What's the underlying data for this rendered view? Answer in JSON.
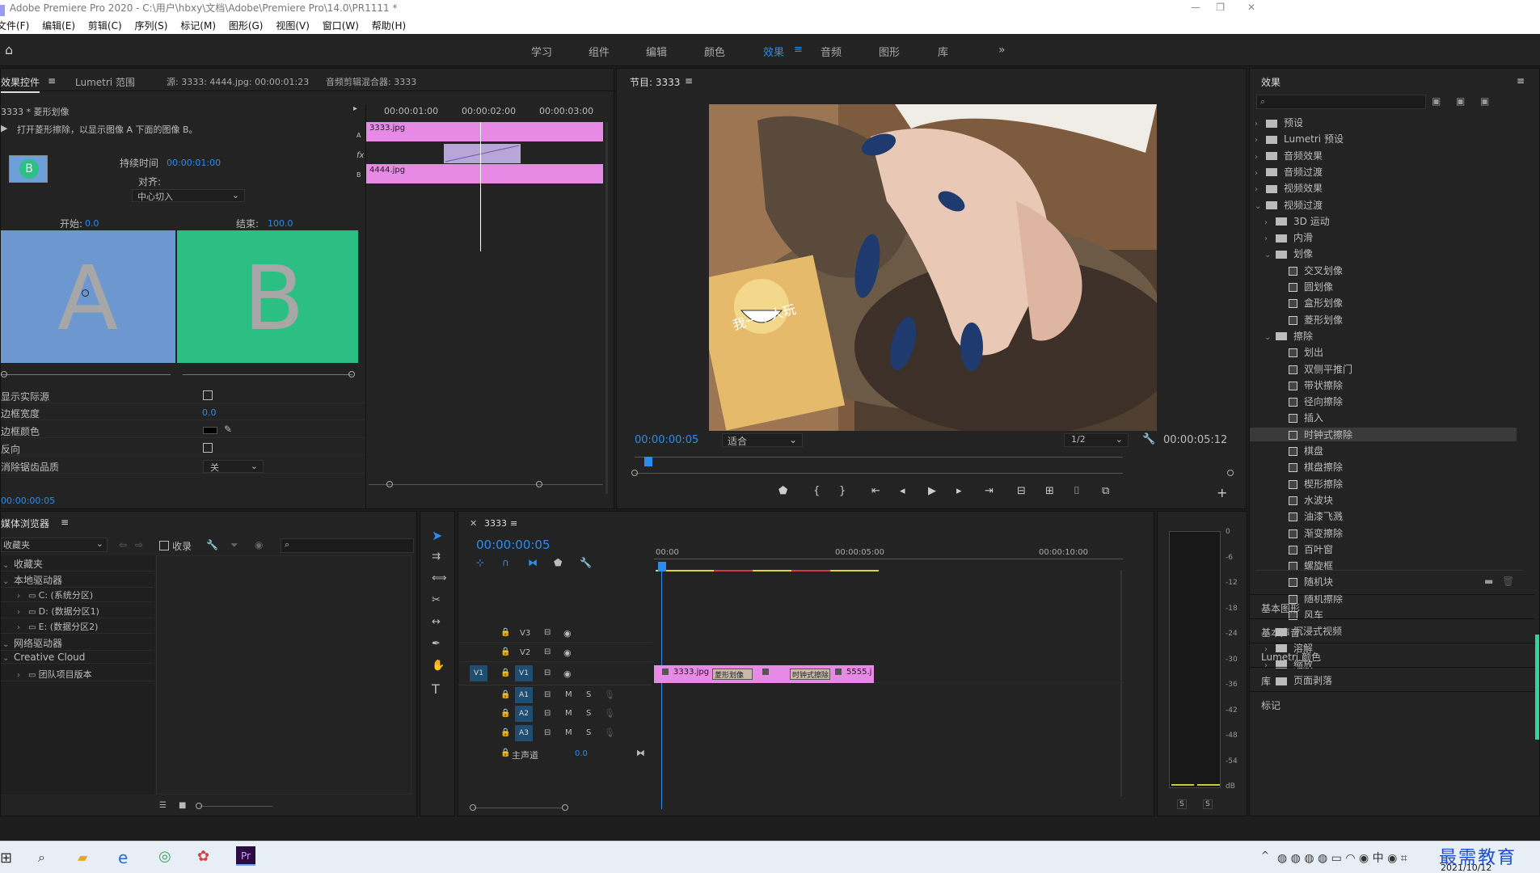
{
  "window": {
    "title": "Adobe Premiere Pro 2020 - C:\\用户\\hbxy\\文档\\Adobe\\Premiere Pro\\14.0\\PR1111 *"
  },
  "menu": [
    "文件(F)",
    "编辑(E)",
    "剪辑(C)",
    "序列(S)",
    "标记(M)",
    "图形(G)",
    "视图(V)",
    "窗口(W)",
    "帮助(H)"
  ],
  "workspaces": [
    "学习",
    "组件",
    "编辑",
    "颜色",
    "效果",
    "音频",
    "图形",
    "库"
  ],
  "workspaces_active": "效果",
  "effect_controls": {
    "tabs": [
      "效果控件",
      "Lumetri 范围",
      "源: 3333: 4444.jpg: 00:00:01:23",
      "音频剪辑混合器: 3333"
    ],
    "clip_name": "3333 * 菱形划像",
    "description": "打开菱形擦除，以显示图像 A 下面的图像 B。",
    "preview_letter": "B",
    "duration_label": "持续时间",
    "duration_value": "00:00:01:00",
    "align_label": "对齐:",
    "align_value": "中心切入",
    "start_label": "开始:",
    "start_value": "0.0",
    "end_label": "结束:",
    "end_value": "100.0",
    "a_letter": "A",
    "b_letter": "B",
    "show_actual": "显示实际源",
    "border_width": "边框宽度",
    "border_width_value": "0.0",
    "border_color": "边框颜色",
    "reverse": "反向",
    "antialias": "消除锯齿品质",
    "antialias_value": "关",
    "timecode": "00:00:00:05",
    "mini_ruler": [
      "00:00:01:00",
      "00:00:02:00",
      "00:00:03:00"
    ],
    "clip_a": "3333.jpg",
    "clip_b": "4444.jpg",
    "lane_a": "A",
    "lane_fx": "fx",
    "lane_b": "B"
  },
  "program": {
    "title": "节目: 3333",
    "timecode": "00:00:00:05",
    "fit": "适合",
    "resolution": "1/2",
    "duration": "00:00:05:12",
    "sticker_text": "我一个人玩"
  },
  "effects_panel": {
    "title": "效果",
    "tree": [
      {
        "label": "预设",
        "level": 0,
        "type": "folder",
        "open": false
      },
      {
        "label": "Lumetri 预设",
        "level": 0,
        "type": "folder",
        "open": false
      },
      {
        "label": "音频效果",
        "level": 0,
        "type": "folder",
        "open": false
      },
      {
        "label": "音频过渡",
        "level": 0,
        "type": "folder",
        "open": false
      },
      {
        "label": "视频效果",
        "level": 0,
        "type": "folder",
        "open": false
      },
      {
        "label": "视频过渡",
        "level": 0,
        "type": "folder",
        "open": true
      },
      {
        "label": "3D 运动",
        "level": 1,
        "type": "folder",
        "open": false
      },
      {
        "label": "内滑",
        "level": 1,
        "type": "folder",
        "open": false
      },
      {
        "label": "划像",
        "level": 1,
        "type": "folder",
        "open": true
      },
      {
        "label": "交叉划像",
        "level": 2,
        "type": "fx"
      },
      {
        "label": "圆划像",
        "level": 2,
        "type": "fx"
      },
      {
        "label": "盒形划像",
        "level": 2,
        "type": "fx"
      },
      {
        "label": "菱形划像",
        "level": 2,
        "type": "fx"
      },
      {
        "label": "擦除",
        "level": 1,
        "type": "folder",
        "open": true
      },
      {
        "label": "划出",
        "level": 2,
        "type": "fx"
      },
      {
        "label": "双侧平推门",
        "level": 2,
        "type": "fx"
      },
      {
        "label": "带状擦除",
        "level": 2,
        "type": "fx"
      },
      {
        "label": "径向擦除",
        "level": 2,
        "type": "fx"
      },
      {
        "label": "插入",
        "level": 2,
        "type": "fx"
      },
      {
        "label": "时钟式擦除",
        "level": 2,
        "type": "fx",
        "selected": true
      },
      {
        "label": "棋盘",
        "level": 2,
        "type": "fx"
      },
      {
        "label": "棋盘擦除",
        "level": 2,
        "type": "fx"
      },
      {
        "label": "楔形擦除",
        "level": 2,
        "type": "fx"
      },
      {
        "label": "水波块",
        "level": 2,
        "type": "fx"
      },
      {
        "label": "油漆飞溅",
        "level": 2,
        "type": "fx"
      },
      {
        "label": "渐变擦除",
        "level": 2,
        "type": "fx"
      },
      {
        "label": "百叶窗",
        "level": 2,
        "type": "fx"
      },
      {
        "label": "螺旋框",
        "level": 2,
        "type": "fx"
      },
      {
        "label": "随机块",
        "level": 2,
        "type": "fx"
      },
      {
        "label": "随机擦除",
        "level": 2,
        "type": "fx"
      },
      {
        "label": "风车",
        "level": 2,
        "type": "fx"
      },
      {
        "label": "沉浸式视频",
        "level": 1,
        "type": "folder",
        "open": false
      },
      {
        "label": "溶解",
        "level": 1,
        "type": "folder",
        "open": false
      },
      {
        "label": "缩放",
        "level": 1,
        "type": "folder",
        "open": false
      },
      {
        "label": "页面剥落",
        "level": 1,
        "type": "folder",
        "open": false
      }
    ],
    "sections": [
      "基本图形",
      "基本声音",
      "Lumetri 颜色",
      "库",
      "标记"
    ]
  },
  "media_browser": {
    "title": "媒体浏览器",
    "favorites_select": "收藏夹",
    "ingest": "收录",
    "tree": [
      {
        "label": "收藏夹",
        "level": 0
      },
      {
        "label": "本地驱动器",
        "level": 0
      },
      {
        "label": "C: (系统分区)",
        "level": 1
      },
      {
        "label": "D: (数据分区1)",
        "level": 1
      },
      {
        "label": "E: (数据分区2)",
        "level": 1
      },
      {
        "label": "网络驱动器",
        "level": 0
      },
      {
        "label": "Creative Cloud",
        "level": 0
      },
      {
        "label": "团队项目版本",
        "level": 1
      }
    ]
  },
  "timeline": {
    "sequence": "3333",
    "timecode": "00:00:00:05",
    "ruler": [
      "00:00",
      "00:00:05:00",
      "00:00:10:00"
    ],
    "video_tracks": [
      "V3",
      "V2",
      "V1"
    ],
    "audio_tracks": [
      "A1",
      "A2",
      "A3"
    ],
    "master": "主声道",
    "master_value": "0.0",
    "clip_labels": [
      "3333.jpg",
      "菱形划像",
      "时钟式擦除",
      "5555.j"
    ],
    "meter_scale": [
      "0",
      "-6",
      "-12",
      "-18",
      "-24",
      "-30",
      "-36",
      "-42",
      "-48",
      "-54",
      "dB"
    ],
    "meter_solo": [
      "S",
      "S"
    ]
  },
  "taskbar": {
    "date": "2021/10/12",
    "watermark": "最需教育"
  }
}
